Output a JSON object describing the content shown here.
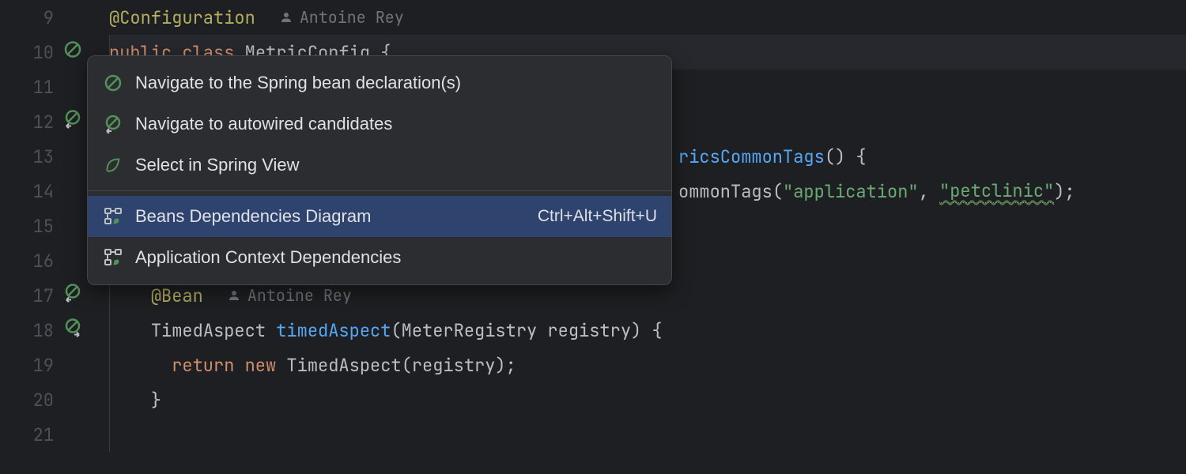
{
  "gutter": {
    "lines": [
      "9",
      "10",
      "11",
      "12",
      "13",
      "14",
      "15",
      "16",
      "17",
      "18",
      "19",
      "20",
      "21"
    ]
  },
  "code": {
    "line9": {
      "annotation": "@Configuration",
      "author": "Antoine Rey"
    },
    "line10": {
      "kw_public": "public",
      "kw_class": "class",
      "classname": "MetricConfig",
      "brace": "{"
    },
    "line13": {
      "suffix_method": "ricsCommonTags",
      "paren_open": "()",
      "brace": " {"
    },
    "line14": {
      "suffix_call": "ommonTags",
      "open": "(",
      "str1": "\"application\"",
      "comma": ", ",
      "str2": "\"petclinic\"",
      "close": ");"
    },
    "line17": {
      "annotation": "@Bean",
      "author": "Antoine Rey"
    },
    "line18": {
      "type": "TimedAspect ",
      "method": "timedAspect",
      "params": "(MeterRegistry registry) {"
    },
    "line19": {
      "kw_return": "return",
      "kw_new": " new",
      "call": " TimedAspect(registry);"
    },
    "line20": {
      "brace": "}"
    }
  },
  "popup": {
    "items": [
      {
        "label": "Navigate to the Spring bean declaration(s)",
        "shortcut": ""
      },
      {
        "label": "Navigate to autowired candidates",
        "shortcut": ""
      },
      {
        "label": "Select in Spring View",
        "shortcut": ""
      },
      {
        "label": "Beans Dependencies Diagram",
        "shortcut": "Ctrl+Alt+Shift+U"
      },
      {
        "label": "Application Context Dependencies",
        "shortcut": ""
      }
    ]
  }
}
